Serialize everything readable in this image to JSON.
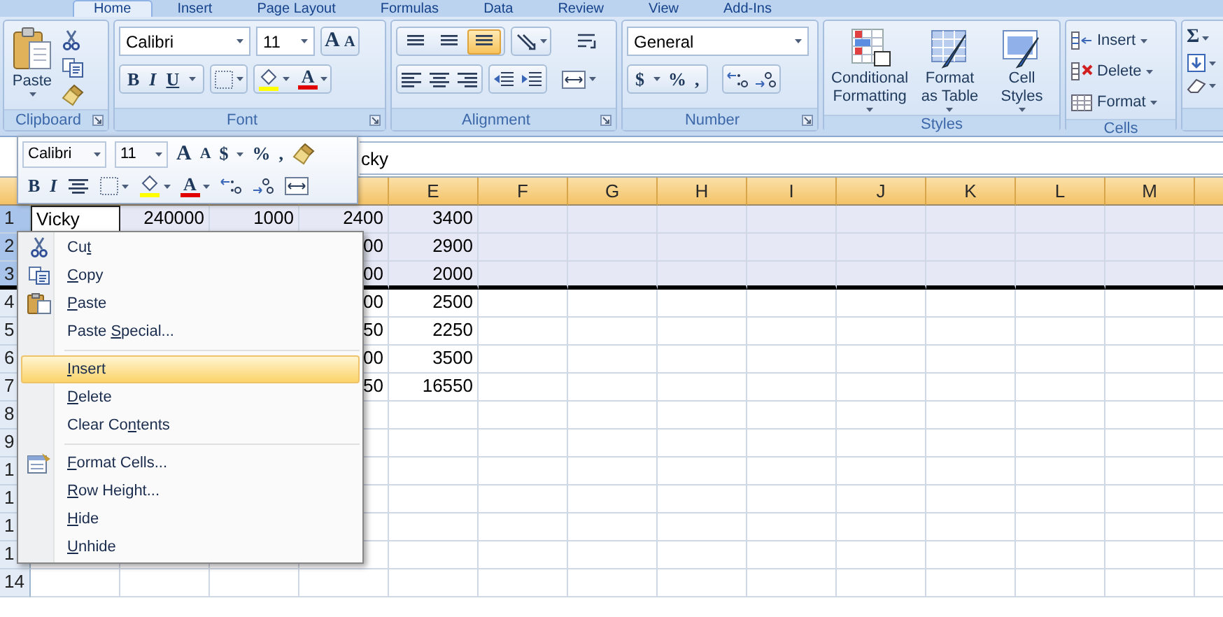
{
  "tabs": [
    {
      "label": "Home",
      "selected": true
    },
    {
      "label": "Insert",
      "selected": false
    },
    {
      "label": "Page Layout",
      "selected": false
    },
    {
      "label": "Formulas",
      "selected": false
    },
    {
      "label": "Data",
      "selected": false
    },
    {
      "label": "Review",
      "selected": false
    },
    {
      "label": "View",
      "selected": false
    },
    {
      "label": "Add-Ins",
      "selected": false
    }
  ],
  "ribbon": {
    "clipboard": {
      "label": "Clipboard",
      "paste": "Paste"
    },
    "font": {
      "label": "Font",
      "font_name": "Calibri",
      "font_size": "11",
      "grow": "A",
      "shrink": "A",
      "bold": "B",
      "italic": "I",
      "underline": "U",
      "font_color": "A"
    },
    "alignment": {
      "label": "Alignment",
      "vertical_align": [
        {
          "selected": false
        },
        {
          "selected": false
        },
        {
          "selected": true
        }
      ]
    },
    "number": {
      "label": "Number",
      "format": "General",
      "currency": "$",
      "percent": "%",
      "comma": ","
    },
    "styles": {
      "label": "Styles",
      "buttons": [
        [
          "Conditional",
          "Formatting"
        ],
        [
          "Format",
          "as Table"
        ],
        [
          "Cell",
          "Styles"
        ]
      ]
    },
    "cells": {
      "label": "Cells",
      "buttons": [
        "Insert",
        "Delete",
        "Format"
      ]
    },
    "editing": {
      "sum": "Σ"
    }
  },
  "formula_bar": {
    "value": "cky"
  },
  "columns": [
    "E",
    "F",
    "G",
    "H",
    "I",
    "J",
    "K",
    "L",
    "M"
  ],
  "rows": [
    {
      "header": "1",
      "selected": true,
      "active": true,
      "a": "Vicky",
      "b": "240000",
      "c": "1000",
      "d": "2400",
      "e": "3400"
    },
    {
      "header": "2",
      "selected": true,
      "d": "00",
      "e": "2900"
    },
    {
      "header": "3",
      "selected": true,
      "d": "00",
      "e": "2000"
    },
    {
      "header": "4",
      "selected": false,
      "d": "00",
      "e": "2500"
    },
    {
      "header": "5",
      "selected": false,
      "d": "50",
      "e": "2250"
    },
    {
      "header": "6",
      "selected": false,
      "d": "00",
      "e": "3500"
    },
    {
      "header": "7",
      "selected": false,
      "d": "50",
      "e": "16550"
    },
    {
      "header": "8",
      "selected": false
    },
    {
      "header": "9",
      "selected": false
    },
    {
      "header": "1",
      "selected": false
    },
    {
      "header": "1",
      "selected": false
    },
    {
      "header": "1",
      "selected": false
    },
    {
      "header": "1",
      "selected": false,
      "active": false
    },
    {
      "header": "14",
      "selected": false,
      "active": false
    }
  ],
  "mini_toolbar": {
    "font_name": "Calibri",
    "font_size": "11",
    "grow": "A",
    "shrink": "A",
    "currency": "$",
    "percent": "%",
    "comma": ",",
    "bold": "B",
    "italic": "I",
    "font_color": "A"
  },
  "context_menu": [
    {
      "kind": "item",
      "before": "Cu",
      "key": "t",
      "selected": false
    },
    {
      "kind": "item",
      "key": "C",
      "after": "opy",
      "selected": false
    },
    {
      "kind": "item",
      "key": "P",
      "after": "aste",
      "selected": false
    },
    {
      "kind": "item",
      "before": "Paste ",
      "key": "S",
      "after": "pecial...",
      "selected": false
    },
    {
      "kind": "separator"
    },
    {
      "kind": "item",
      "key": "I",
      "after": "nsert",
      "selected": true
    },
    {
      "kind": "item",
      "key": "D",
      "after": "elete",
      "selected": false
    },
    {
      "kind": "item",
      "before": "Clear Co",
      "key": "n",
      "after": "tents",
      "selected": false
    },
    {
      "kind": "separator"
    },
    {
      "kind": "item",
      "key": "F",
      "after": "ormat Cells...",
      "selected": false
    },
    {
      "kind": "item",
      "key": "R",
      "after": "ow Height...",
      "selected": false
    },
    {
      "kind": "item",
      "key": "H",
      "after": "ide",
      "selected": false
    },
    {
      "kind": "item",
      "key": "U",
      "after": "nhide",
      "selected": false
    }
  ]
}
